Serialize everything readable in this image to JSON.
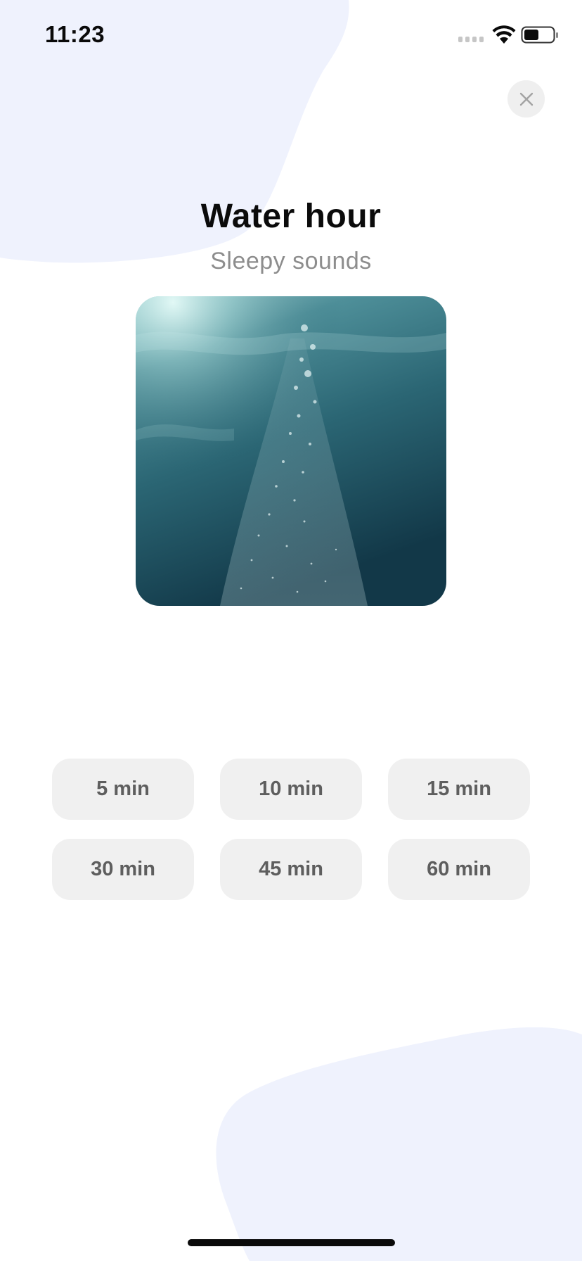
{
  "status_bar": {
    "time": "11:23",
    "icons": [
      "cellular-signal-icon",
      "wifi-icon",
      "battery-icon"
    ]
  },
  "header": {
    "close_icon": "close-icon"
  },
  "sound": {
    "title": "Water hour",
    "subtitle": "Sleepy sounds",
    "artwork": "underwater bubbles photo"
  },
  "durations": [
    "5 min",
    "10 min",
    "15 min",
    "30 min",
    "45 min",
    "60 min"
  ],
  "colors": {
    "background": "#ffffff",
    "blob": "#eff2fd",
    "button": "#f0f0f0",
    "button_text": "#5e5e5e",
    "title": "#0b0b0b",
    "subtitle": "#8d8d8d"
  }
}
